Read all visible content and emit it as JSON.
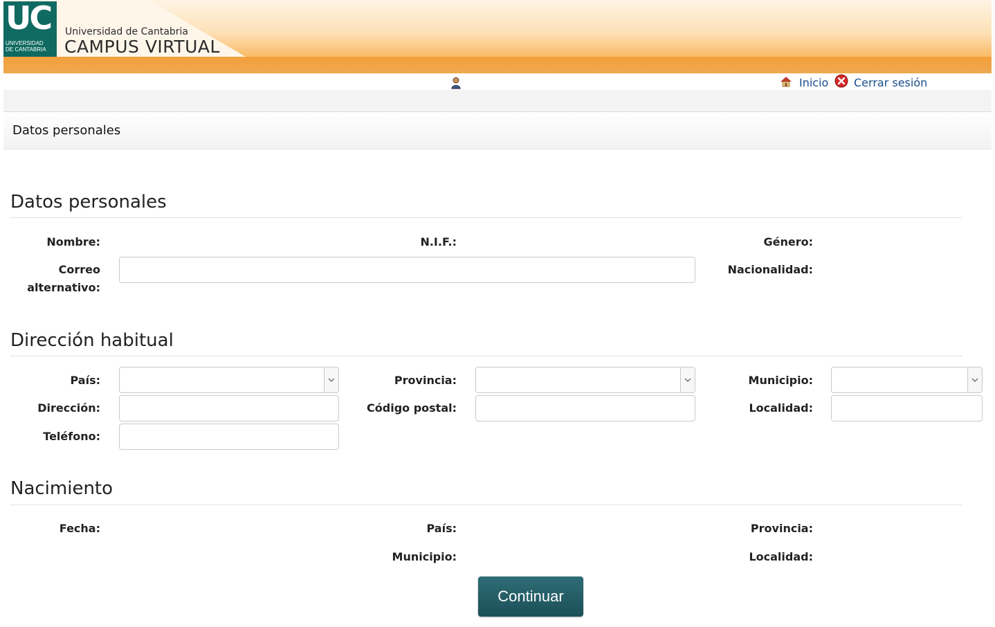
{
  "header": {
    "logo_mark": "UC",
    "logo_line1": "UNIVERSIDAD",
    "logo_line2": "DE CANTABRIA",
    "university": "Universidad de Cantabria",
    "site_title": "CAMPUS VIRTUAL"
  },
  "nav": {
    "home_label": "Inicio",
    "logout_label": "Cerrar sesión",
    "user_icon": "user-icon",
    "home_icon": "home-icon",
    "logout_icon": "close-circle-icon"
  },
  "page": {
    "section_title": "Datos personales"
  },
  "personal": {
    "heading": "Datos personales",
    "nombre_label": "Nombre:",
    "nif_label": "N.I.F.:",
    "genero_label": "Género:",
    "correo_label_1": "Correo",
    "correo_label_2": "alternativo:",
    "correo_value": "",
    "nacionalidad_label": "Nacionalidad:"
  },
  "address": {
    "heading": "Dirección habitual",
    "pais_label": "País:",
    "pais_value": "",
    "provincia_label": "Provincia:",
    "provincia_value": "",
    "municipio_label": "Municipio:",
    "municipio_value": "",
    "direccion_label": "Dirección:",
    "direccion_value": "",
    "codigo_postal_label": "Código postal:",
    "codigo_postal_value": "",
    "localidad_label": "Localidad:",
    "localidad_value": "",
    "telefono_label": "Teléfono:",
    "telefono_value": ""
  },
  "birth": {
    "heading": "Nacimiento",
    "fecha_label": "Fecha:",
    "pais_label": "País:",
    "provincia_label": "Provincia:",
    "municipio_label": "Municipio:",
    "localidad_label": "Localidad:"
  },
  "actions": {
    "continue_label": "Continuar"
  },
  "colors": {
    "header_orange": "#f4a640",
    "logo_green": "#0f6a62",
    "link_blue": "#1a4d8c",
    "button_teal": "#245b63"
  }
}
